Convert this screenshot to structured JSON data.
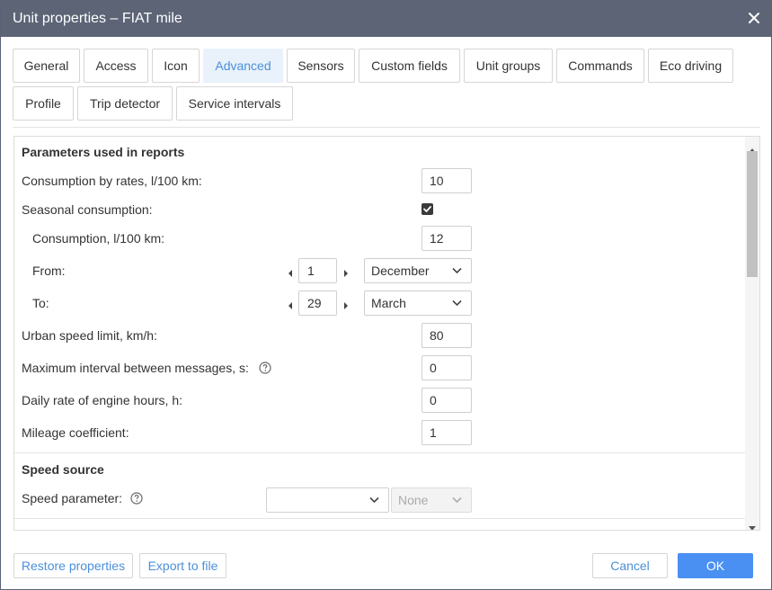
{
  "window": {
    "title": "Unit properties – FIAT mile"
  },
  "tabs": [
    {
      "label": "General"
    },
    {
      "label": "Access"
    },
    {
      "label": "Icon"
    },
    {
      "label": "Advanced"
    },
    {
      "label": "Sensors"
    },
    {
      "label": "Custom fields"
    },
    {
      "label": "Unit groups"
    },
    {
      "label": "Commands"
    },
    {
      "label": "Eco driving"
    },
    {
      "label": "Profile"
    },
    {
      "label": "Trip detector"
    },
    {
      "label": "Service intervals"
    }
  ],
  "active_tab": "Advanced",
  "reports": {
    "title": "Parameters used in reports",
    "consumption_rates_label": "Consumption by rates, l/100 km:",
    "consumption_rates_value": "10",
    "seasonal_label": "Seasonal consumption:",
    "seasonal_checked": true,
    "seasonal_consumption_label": "Consumption, l/100 km:",
    "seasonal_consumption_value": "12",
    "from_label": "From:",
    "from_day": "1",
    "from_month": "December",
    "to_label": "To:",
    "to_day": "29",
    "to_month": "March",
    "urban_speed_label": "Urban speed limit, km/h:",
    "urban_speed_value": "80",
    "max_interval_label": "Maximum interval between messages, s:",
    "max_interval_value": "0",
    "engine_hours_label": "Daily rate of engine hours, h:",
    "engine_hours_value": "0",
    "mileage_label": "Mileage coefficient:",
    "mileage_value": "1"
  },
  "speed_source": {
    "title": "Speed source",
    "param_label": "Speed parameter:",
    "param_value": "",
    "secondary_value": "None"
  },
  "footer": {
    "restore_label": "Restore properties",
    "export_label": "Export to file",
    "cancel_label": "Cancel",
    "ok_label": "OK"
  },
  "icons": {
    "close": "close-icon",
    "help": "help-icon",
    "chevron": "chevron-down-icon",
    "check": "check-icon"
  }
}
